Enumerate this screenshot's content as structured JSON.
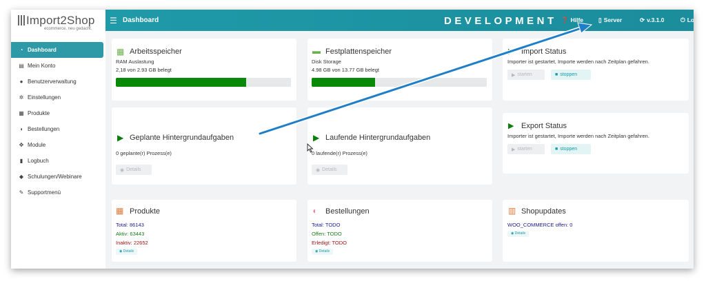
{
  "logo": {
    "name": "Import2Shop",
    "tagline": "ecommerce. neu gedacht."
  },
  "sidebar": {
    "items": [
      {
        "label": "Dashboard",
        "icon": "dashboard-icon",
        "active": true
      },
      {
        "label": "Mein Konto",
        "icon": "account-icon"
      },
      {
        "label": "Benutzerverwaltung",
        "icon": "users-icon"
      },
      {
        "label": "Einstellungen",
        "icon": "gears-icon"
      },
      {
        "label": "Produkte",
        "icon": "boxes-icon"
      },
      {
        "label": "Bestellungen",
        "icon": "piggy-bank-icon"
      },
      {
        "label": "Module",
        "icon": "modules-icon"
      },
      {
        "label": "Logbuch",
        "icon": "logbook-icon"
      },
      {
        "label": "Schulungen/Webinare",
        "icon": "graduation-icon"
      },
      {
        "label": "Supportmenü",
        "icon": "support-icon"
      }
    ]
  },
  "topbar": {
    "title": "Dashboard",
    "environment": "DEVELOPMENT",
    "help": "Hilfe",
    "server": "Server",
    "version": "v.3.1.0",
    "logout": "Logou"
  },
  "cards": {
    "ram": {
      "title": "Arbeitsspeicher",
      "subtitle": "RAM Auslastung",
      "usage": "2,18 von 2.93 GB belegt",
      "fill_percent": 74.4
    },
    "disk": {
      "title": "Festplattenspeicher",
      "subtitle": "Disk Storage",
      "usage": "4.98 GB von 13.77 GB belegt",
      "fill_percent": 36.2
    },
    "import": {
      "title": "Import Status",
      "message": "Importer ist gestartet, Importe werden nach Zeitplan gefahren.",
      "start_label": "starten",
      "stop_label": "stoppen"
    },
    "planned": {
      "title": "Geplante Hintergrundaufgaben",
      "count": "0 geplante(r) Prozess(e)",
      "details_label": "Details"
    },
    "running": {
      "title": "Laufende Hintergrundaufgaben",
      "count": "0 laufende(r) Prozess(e)",
      "details_label": "Details"
    },
    "export": {
      "title": "Export Status",
      "message": "Importer ist gestartet, Importe werden nach Zeitplan gefahren.",
      "start_label": "starten",
      "stop_label": "stoppen"
    },
    "products": {
      "title": "Produkte",
      "total": "Total: 86143",
      "active": "Aktiv: 63443",
      "inactive": "Inaktiv: 22652",
      "details_label": "Details"
    },
    "orders": {
      "title": "Bestellungen",
      "total": "Total: TODO",
      "open": "Offen: TODO",
      "done": "Erledigt: TODO",
      "details_label": "Details"
    },
    "shopupdates": {
      "title": "Shopupdates",
      "woo": "WOO_COMMERCE offen: 0",
      "details_label": "Details"
    }
  },
  "colors": {
    "accent": "#1f9aa8",
    "progress": "#088a08",
    "play": "#0b7d0b",
    "blue_text": "#1a1a8c",
    "green_text": "#1a7a1a",
    "red_text": "#a11313",
    "annotation_arrow": "#1e7fc8"
  }
}
